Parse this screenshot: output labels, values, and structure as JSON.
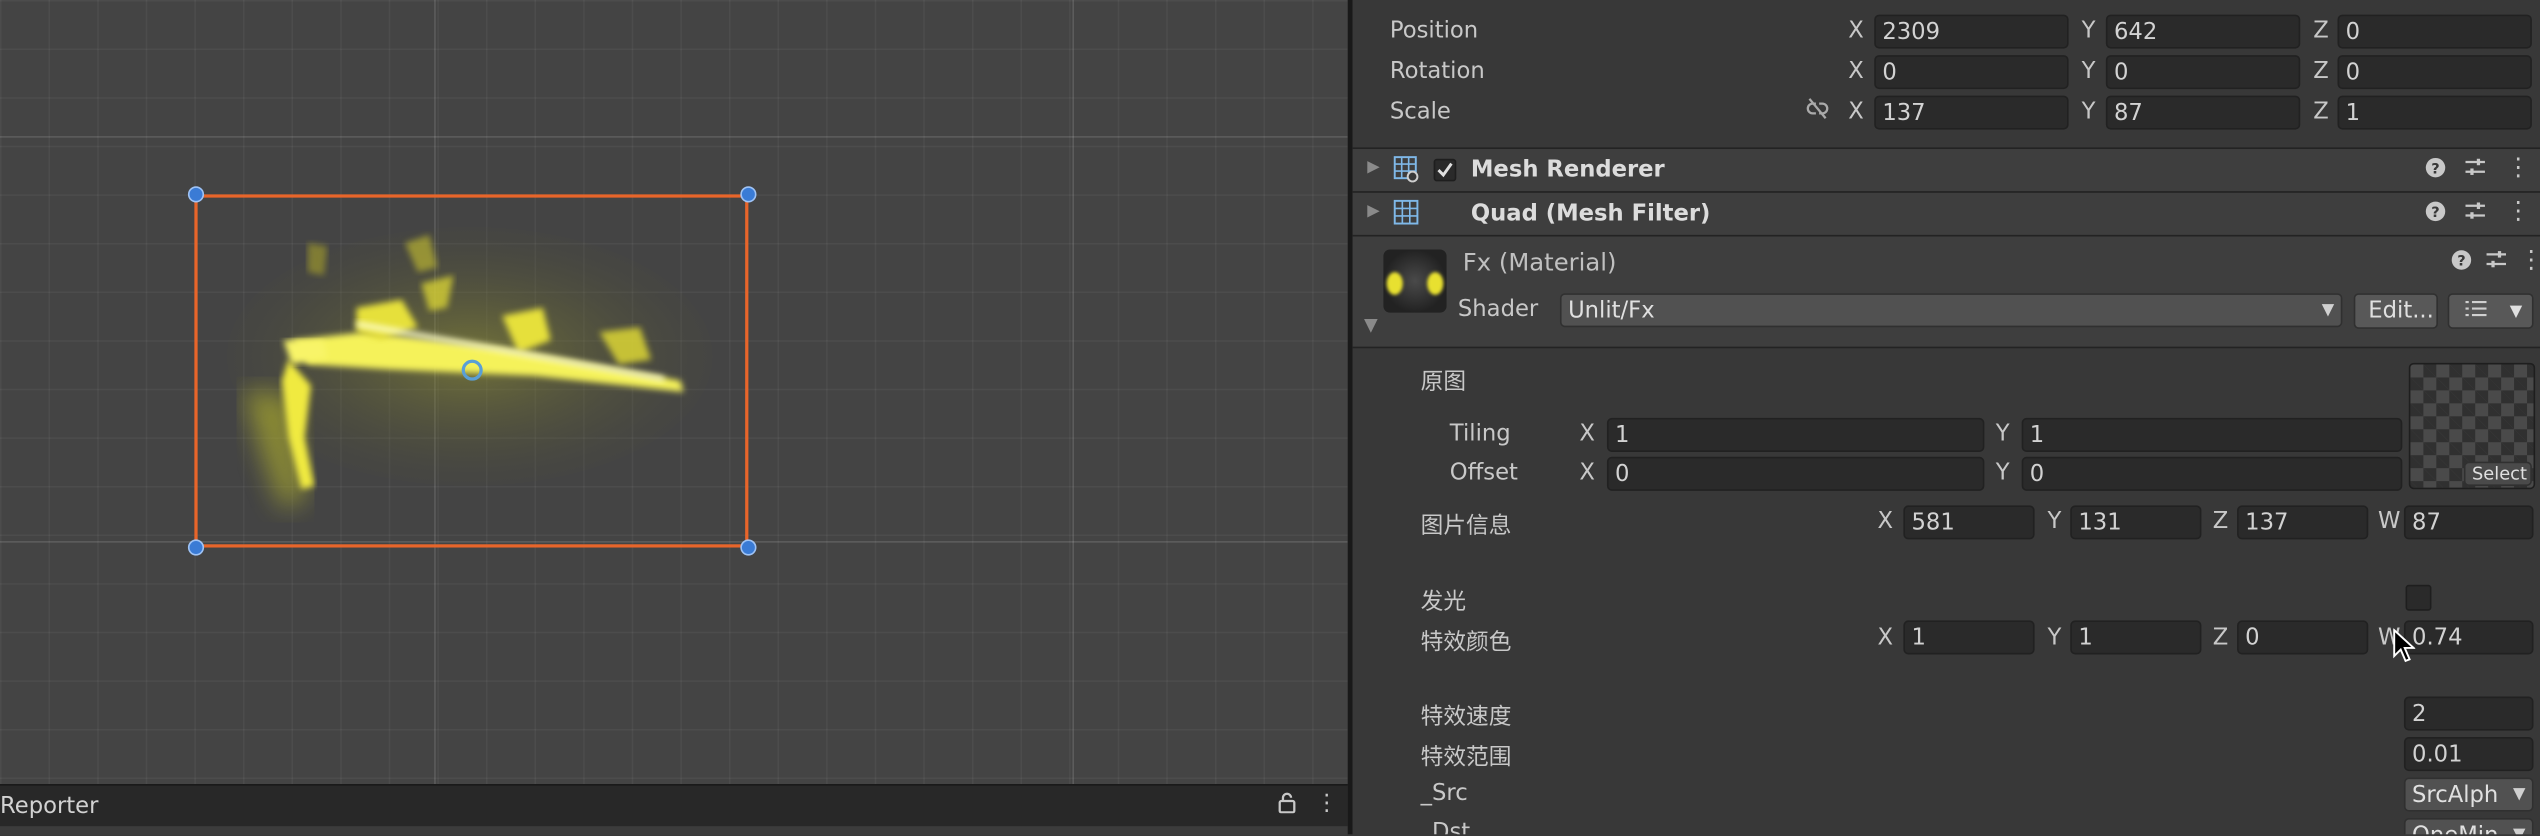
{
  "scene_view": {
    "reporter_title": "Reporter",
    "reporter_lock_icon": "lock-icon",
    "reporter_menu_icon": "kebab-menu-icon"
  },
  "transform": {
    "position": {
      "label": "Position",
      "x_label": "X",
      "x": "2309",
      "y_label": "Y",
      "y": "642",
      "z_label": "Z",
      "z": "0"
    },
    "rotation": {
      "label": "Rotation",
      "x_label": "X",
      "x": "0",
      "y_label": "Y",
      "y": "0",
      "z_label": "Z",
      "z": "0"
    },
    "scale": {
      "label": "Scale",
      "x_label": "X",
      "x": "137",
      "y_label": "Y",
      "y": "87",
      "z_label": "Z",
      "z": "1",
      "link_icon": "unlink-icon"
    }
  },
  "components": {
    "mesh_renderer": {
      "title": "Mesh Renderer",
      "enabled": true
    },
    "mesh_filter": {
      "title": "Quad (Mesh Filter)"
    }
  },
  "material": {
    "title": "Fx (Material)",
    "shader_label": "Shader",
    "shader_value": "Unlit/Fx",
    "edit_button": "Edit...",
    "texture_select": "Select",
    "properties": {
      "main_tex_label": "原图",
      "tiling_label": "Tiling",
      "tiling_x_label": "X",
      "tiling_x": "1",
      "tiling_y_label": "Y",
      "tiling_y": "1",
      "offset_label": "Offset",
      "offset_x_label": "X",
      "offset_x": "0",
      "offset_y_label": "Y",
      "offset_y": "0",
      "img_info_label": "图片信息",
      "img_info": {
        "x_label": "X",
        "x": "581",
        "y_label": "Y",
        "y": "131",
        "z_label": "Z",
        "z": "137",
        "w_label": "W",
        "w": "87"
      },
      "glow_label": "发光",
      "glow_enabled": false,
      "fx_color_label": "特效颜色",
      "fx_color": {
        "x_label": "X",
        "x": "1",
        "y_label": "Y",
        "y": "1",
        "z_label": "Z",
        "z": "0",
        "w_label": "W",
        "w": "0.74"
      },
      "fx_speed_label": "特效速度",
      "fx_speed": "2",
      "fx_range_label": "特效范围",
      "fx_range": "0.01",
      "src_label": "_Src",
      "src_value": "SrcAlph",
      "dst_label": "_Dst",
      "dst_value": "OneMin"
    }
  },
  "colors": {
    "accent_selection": "#e8652a",
    "handle_blue": "#3a7bd5",
    "glow_yellow": "#f5f25a"
  }
}
